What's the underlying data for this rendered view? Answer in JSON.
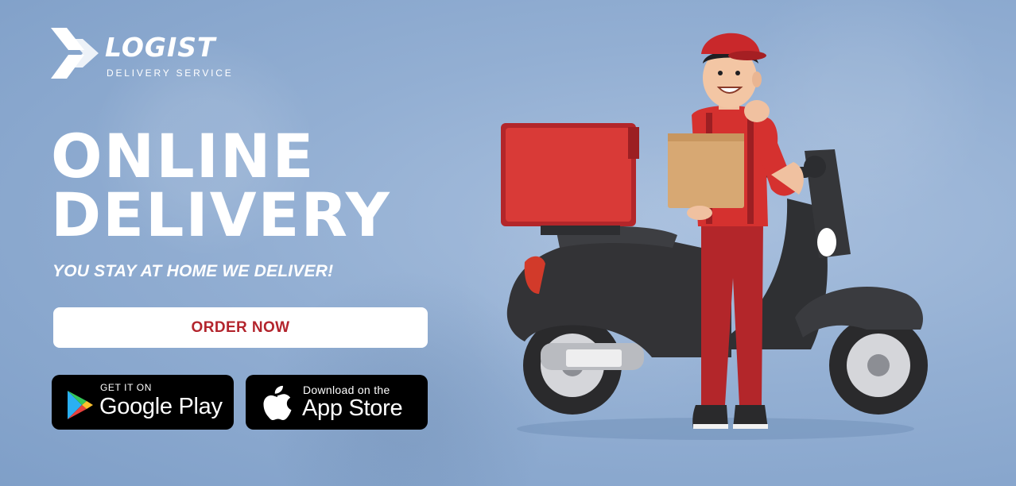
{
  "brand": {
    "name": "LOGIST",
    "tagline": "DELIVERY SERVICE"
  },
  "hero": {
    "headline_line1": "ONLINE",
    "headline_line2": "DELIVERY",
    "subheadline": "YOU STAY AT HOME WE DELIVER!"
  },
  "cta": {
    "order_label": "ORDER NOW"
  },
  "stores": {
    "google": {
      "small": "GET IT ON",
      "big": "Google Play",
      "icon": "google-play-icon"
    },
    "apple": {
      "small": "Download on the",
      "big": "App Store",
      "icon": "apple-icon"
    }
  },
  "colors": {
    "background": "#93afd3",
    "accent": "#b3252d",
    "button_bg": "#ffffff",
    "store_bg": "#000000"
  },
  "illustration": {
    "subject": "delivery-man-with-scooter"
  }
}
